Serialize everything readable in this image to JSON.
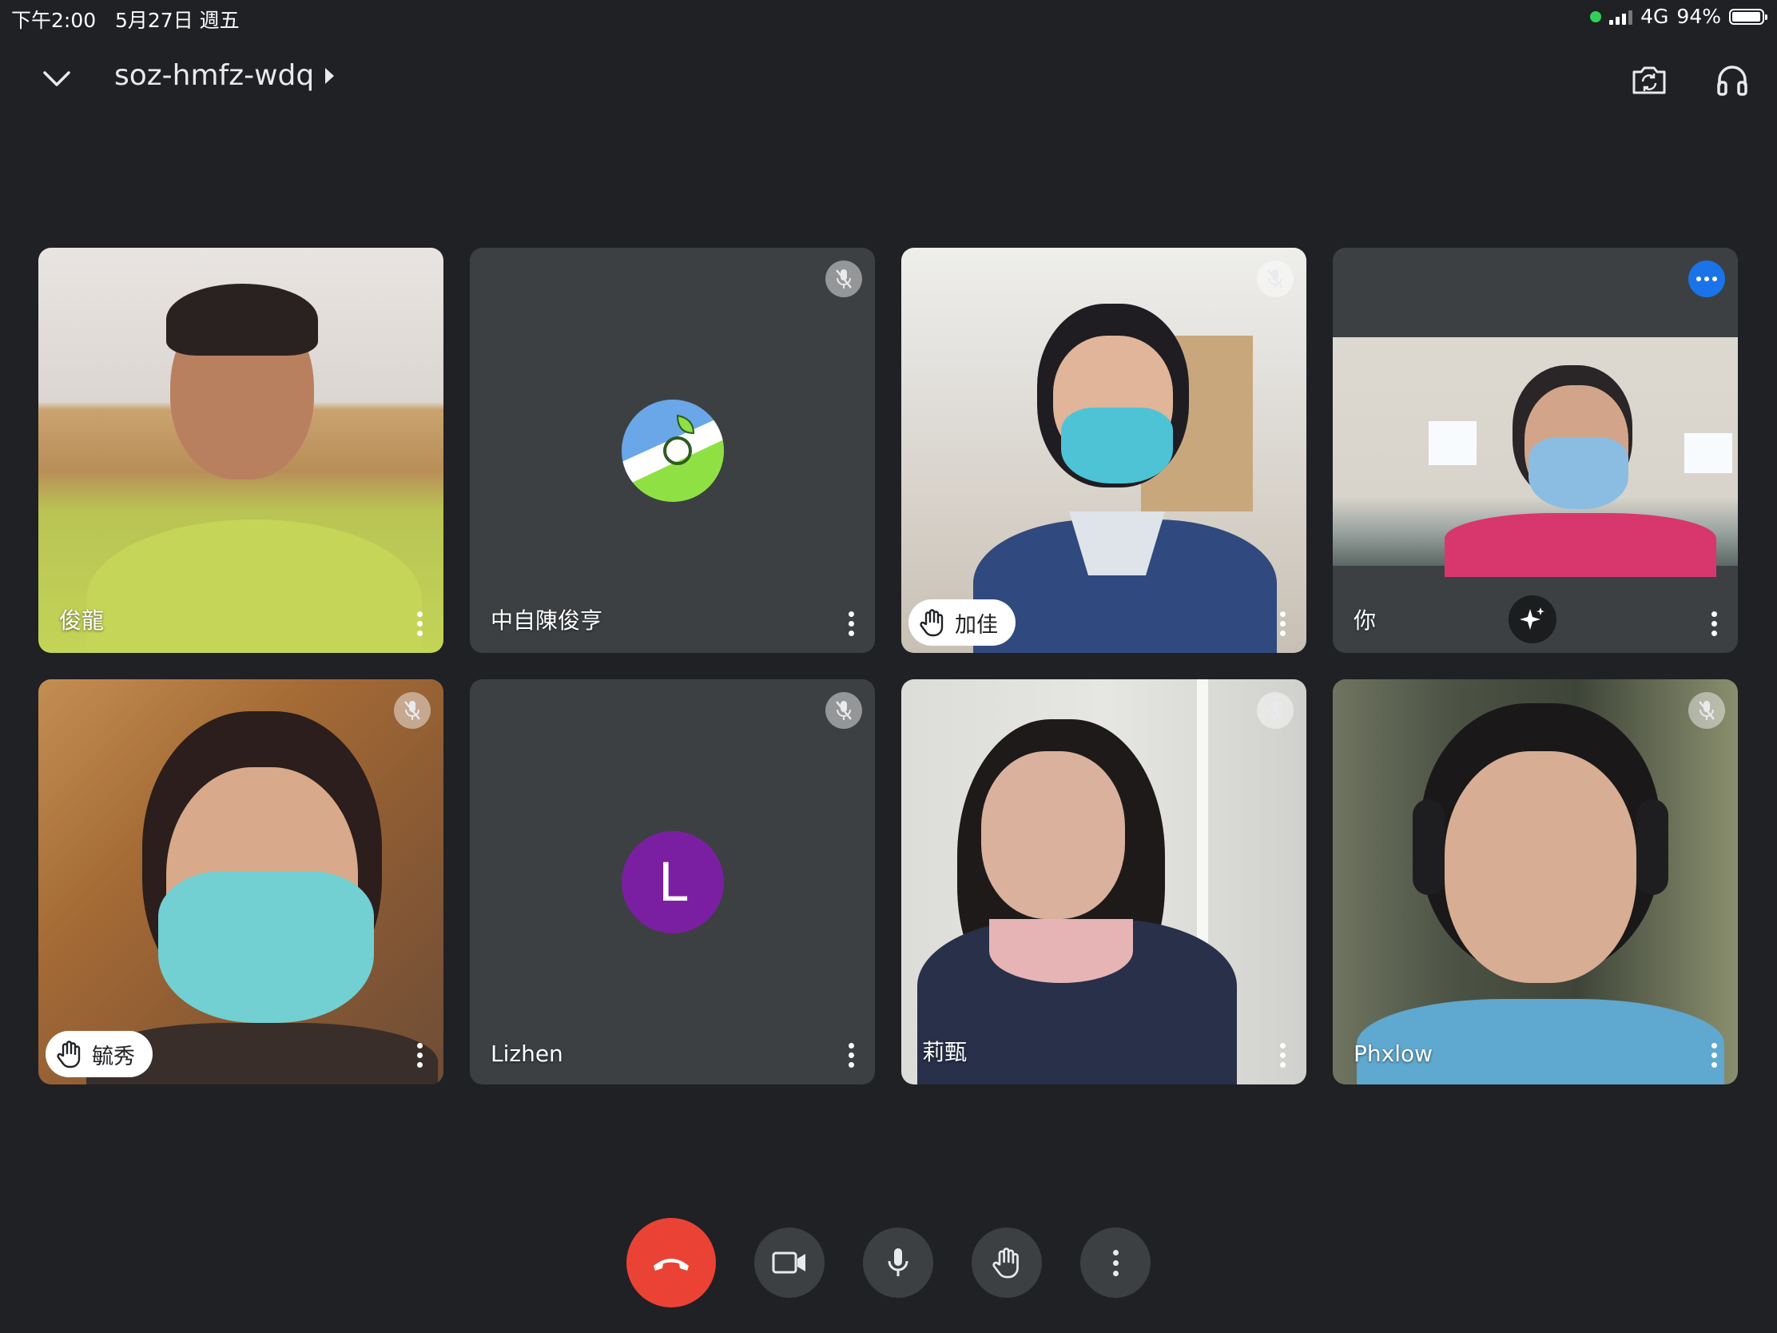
{
  "status_bar": {
    "time": "下午2:00",
    "date": "5月27日 週五",
    "network": "4G",
    "battery": "94%",
    "battery_level": 0.94
  },
  "header": {
    "meeting_code": "soz-hmfz-wdq",
    "icons": [
      "chevron-down-icon",
      "switch-camera-icon",
      "headphones-icon"
    ]
  },
  "tiles": [
    {
      "name": "俊龍",
      "muted": false,
      "hand_raised": false,
      "type": "video"
    },
    {
      "name": "中自陳俊亨",
      "muted": true,
      "hand_raised": false,
      "type": "avatar"
    },
    {
      "name": "加佳",
      "muted": true,
      "hand_raised": true,
      "type": "video"
    },
    {
      "name": "你",
      "muted": false,
      "hand_raised": false,
      "type": "self-video"
    },
    {
      "name": "毓秀",
      "muted": true,
      "hand_raised": true,
      "type": "video"
    },
    {
      "name": "Lizhen",
      "muted": true,
      "hand_raised": false,
      "type": "letter-avatar",
      "initial": "L",
      "color": "#7b1fa2"
    },
    {
      "name": "莉甄",
      "muted": true,
      "hand_raised": false,
      "type": "video"
    },
    {
      "name": "Phxlow",
      "muted": true,
      "hand_raised": false,
      "type": "video"
    }
  ],
  "controls": [
    {
      "name": "end-call",
      "color": "#ea4335"
    },
    {
      "name": "camera",
      "color": "#3c4043"
    },
    {
      "name": "microphone",
      "color": "#3c4043"
    },
    {
      "name": "raise-hand",
      "color": "#3c4043"
    },
    {
      "name": "more-options",
      "color": "#3c4043"
    }
  ]
}
